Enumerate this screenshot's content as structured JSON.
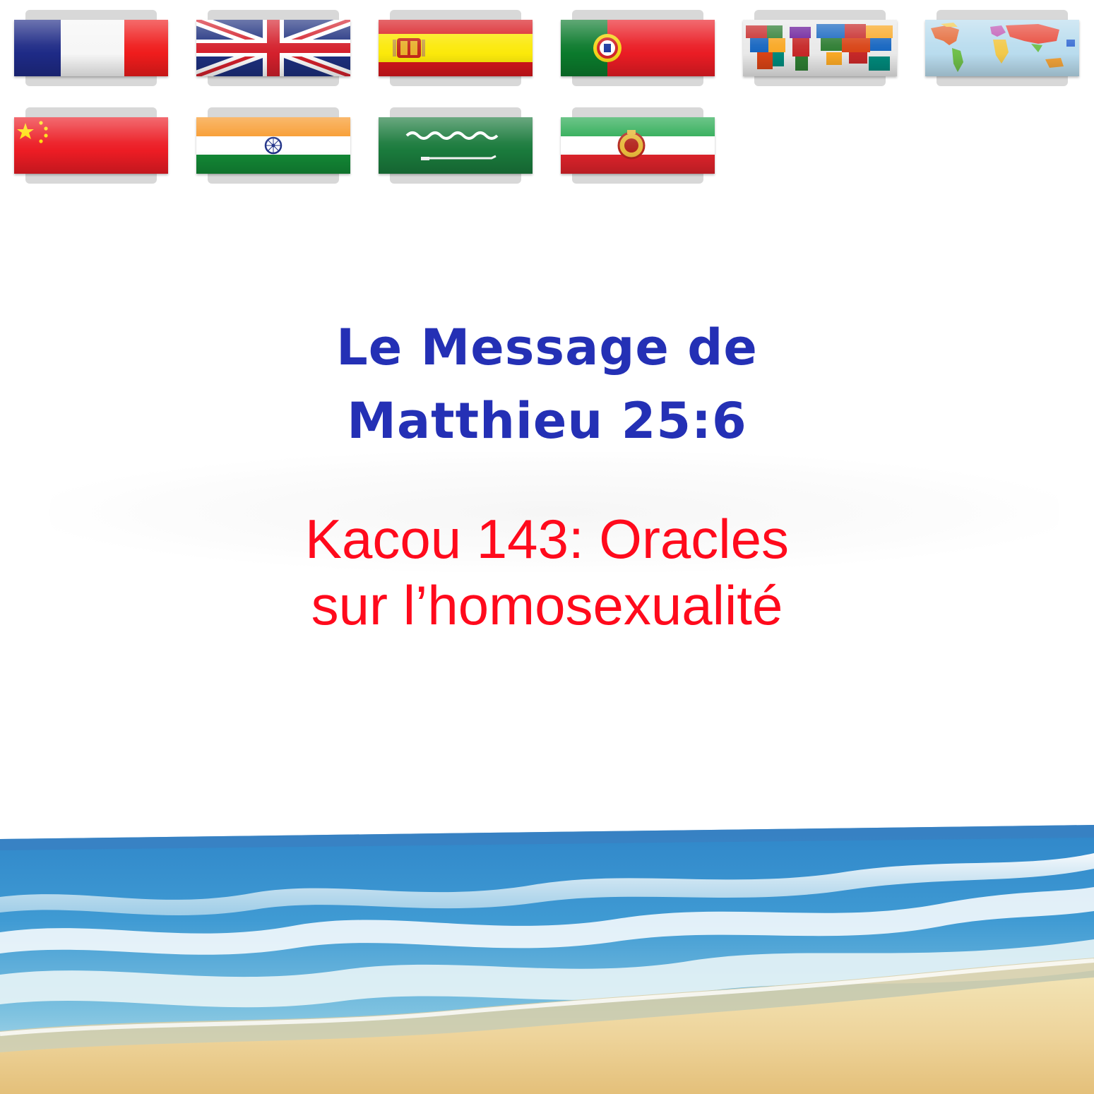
{
  "languages": [
    {
      "flag": "france-flag"
    },
    {
      "flag": "united-kingdom-flag"
    },
    {
      "flag": "spain-flag"
    },
    {
      "flag": "portugal-flag"
    },
    {
      "flag": "world-flags-map"
    },
    {
      "flag": "world-map"
    },
    {
      "flag": "china-flag"
    },
    {
      "flag": "india-flag"
    },
    {
      "flag": "saudi-arabia-flag"
    },
    {
      "flag": "iran-flag"
    }
  ],
  "title": {
    "line1": "Le Message de",
    "line2": "Matthieu 25:6",
    "color": "#2430b5"
  },
  "subtitle": {
    "line1": "Kacou 143: Oracles",
    "line2": "sur l’homosexualité",
    "color": "#ff0a1c"
  }
}
